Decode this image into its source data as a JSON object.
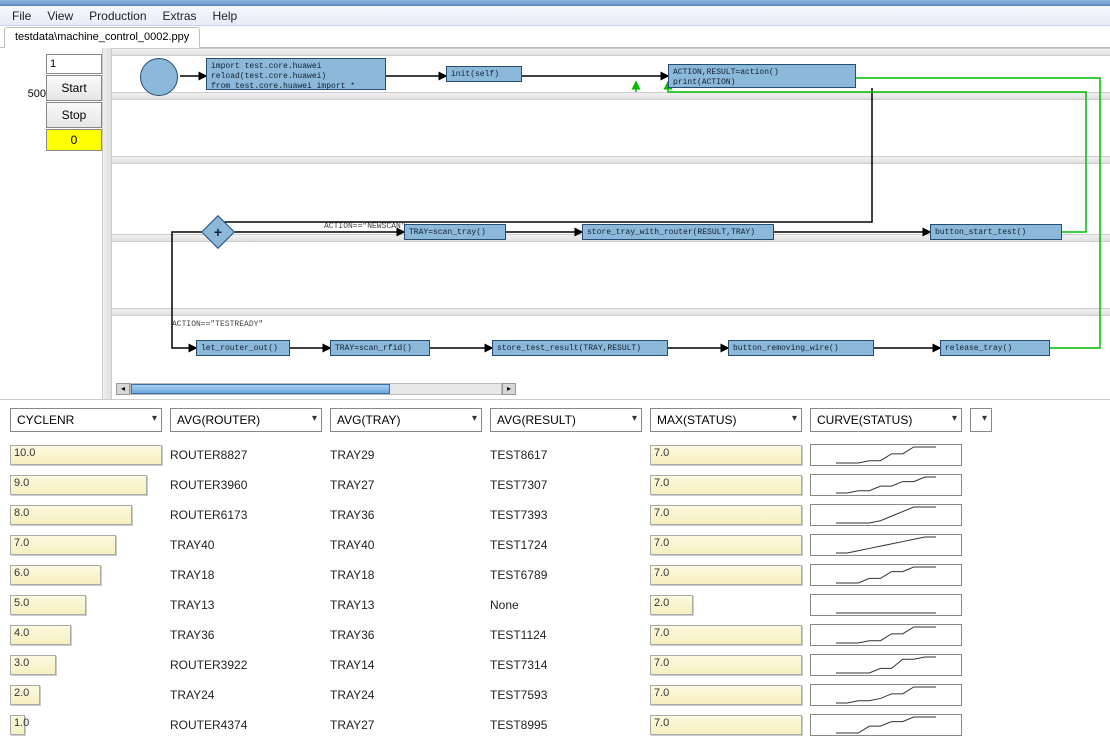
{
  "menu": {
    "items": [
      "File",
      "View",
      "Production",
      "Extras",
      "Help"
    ]
  },
  "tab": {
    "label": "testdata\\machine_control_0002.ppy"
  },
  "left": {
    "scale_value": "500",
    "input_value": "1",
    "start_label": "Start",
    "stop_label": "Stop",
    "counter": "0"
  },
  "flow": {
    "n_import": "import test.core.huawei\nreload(test.core.huawei)\nfrom test.core.huawei import *",
    "n_init": "init(self)",
    "n_action": "ACTION,RESULT=action()\nprint(ACTION)",
    "lbl_newscan": "ACTION==\"NEWSCAN\"",
    "n_scantray": "TRAY=scan_tray()",
    "n_store_tray": "store_tray_with_router(RESULT,TRAY)",
    "n_button_start": "button_start_test()",
    "lbl_testready": "ACTION==\"TESTREADY\"",
    "n_letrouter": "let_router_out()",
    "n_scanrfid": "TRAY=scan_rfid()",
    "n_store_result": "store_test_result(TRAY,RESULT)",
    "n_removing": "button_removing_wire()",
    "n_release": "release_tray()"
  },
  "columns": [
    "CYCLENR",
    "AVG(ROUTER)",
    "AVG(TRAY)",
    "AVG(RESULT)",
    "MAX(STATUS)",
    "CURVE(STATUS)"
  ],
  "rows": [
    {
      "cyclenr": 10.0,
      "router": "ROUTER8827",
      "tray": "TRAY29",
      "result": "TEST8617",
      "status": 7.0,
      "curve": [
        0,
        0,
        0,
        1,
        1,
        4,
        4,
        7,
        7,
        7
      ]
    },
    {
      "cyclenr": 9.0,
      "router": "ROUTER3960",
      "tray": "TRAY27",
      "result": "TEST7307",
      "status": 7.0,
      "curve": [
        0,
        0,
        1,
        1,
        3,
        3,
        5,
        5,
        7,
        7
      ]
    },
    {
      "cyclenr": 8.0,
      "router": "ROUTER6173",
      "tray": "TRAY36",
      "result": "TEST7393",
      "status": 7.0,
      "curve": [
        0,
        0,
        0,
        0,
        1,
        3,
        5,
        7,
        7,
        7
      ]
    },
    {
      "cyclenr": 7.0,
      "router": "TRAY40",
      "tray": "TRAY40",
      "result": "TEST1724",
      "status": 7.0,
      "curve": [
        0,
        0,
        1,
        2,
        3,
        4,
        5,
        6,
        7,
        7
      ]
    },
    {
      "cyclenr": 6.0,
      "router": "TRAY18",
      "tray": "TRAY18",
      "result": "TEST6789",
      "status": 7.0,
      "curve": [
        0,
        0,
        0,
        2,
        2,
        5,
        5,
        7,
        7,
        7
      ]
    },
    {
      "cyclenr": 5.0,
      "router": "TRAY13",
      "tray": "TRAY13",
      "result": "None",
      "status": 2.0,
      "curve": [
        0,
        0,
        0,
        0,
        0,
        0,
        0,
        0,
        0,
        0
      ]
    },
    {
      "cyclenr": 4.0,
      "router": "TRAY36",
      "tray": "TRAY36",
      "result": "TEST1124",
      "status": 7.0,
      "curve": [
        0,
        0,
        0,
        1,
        1,
        4,
        4,
        7,
        7,
        7
      ]
    },
    {
      "cyclenr": 3.0,
      "router": "ROUTER3922",
      "tray": "TRAY14",
      "result": "TEST7314",
      "status": 7.0,
      "curve": [
        0,
        0,
        0,
        0,
        2,
        2,
        6,
        6,
        7,
        7
      ]
    },
    {
      "cyclenr": 2.0,
      "router": "TRAY24",
      "tray": "TRAY24",
      "result": "TEST7593",
      "status": 7.0,
      "curve": [
        0,
        0,
        1,
        1,
        2,
        4,
        4,
        7,
        7,
        7
      ]
    },
    {
      "cyclenr": 1.0,
      "router": "ROUTER4374",
      "tray": "TRAY27",
      "result": "TEST8995",
      "status": 7.0,
      "curve": [
        0,
        0,
        0,
        3,
        3,
        5,
        5,
        7,
        7,
        7
      ]
    }
  ],
  "chart_data": {
    "type": "table",
    "columns": [
      "CYCLENR",
      "AVG(ROUTER)",
      "AVG(TRAY)",
      "AVG(RESULT)",
      "MAX(STATUS)"
    ],
    "cyclenr_range": [
      1.0,
      10.0
    ],
    "status_range": [
      0,
      7.0
    ],
    "series": [
      {
        "name": "CYCLENR",
        "values": [
          10.0,
          9.0,
          8.0,
          7.0,
          6.0,
          5.0,
          4.0,
          3.0,
          2.0,
          1.0
        ]
      },
      {
        "name": "MAX(STATUS)",
        "values": [
          7.0,
          7.0,
          7.0,
          7.0,
          7.0,
          2.0,
          7.0,
          7.0,
          7.0,
          7.0
        ]
      }
    ]
  }
}
